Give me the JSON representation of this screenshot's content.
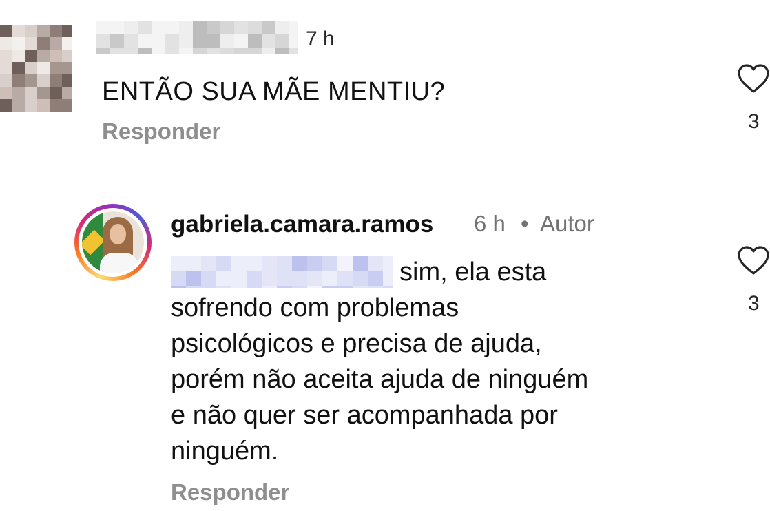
{
  "comments": [
    {
      "time": "7 h",
      "text": "ENTÃO SUA MÃE MENTIU?",
      "reply_label": "Responder",
      "like_count": "3"
    },
    {
      "username": "gabriela.camara.ramos",
      "time": "6 h",
      "separator": "•",
      "author_badge": "Autor",
      "text_lines": [
        "sim, ela esta",
        "sofrendo com problemas",
        "psicológicos e precisa de ajuda,",
        "porém não aceita ajuda de ninguém",
        "e não quer ser acompanhada por",
        "ninguém."
      ],
      "reply_label": "Responder",
      "like_count": "3"
    }
  ],
  "icons": {
    "like": "heart-outline-icon"
  },
  "colors": {
    "secondary_text": "#8e8e8e",
    "story_ring": "#d62976"
  }
}
